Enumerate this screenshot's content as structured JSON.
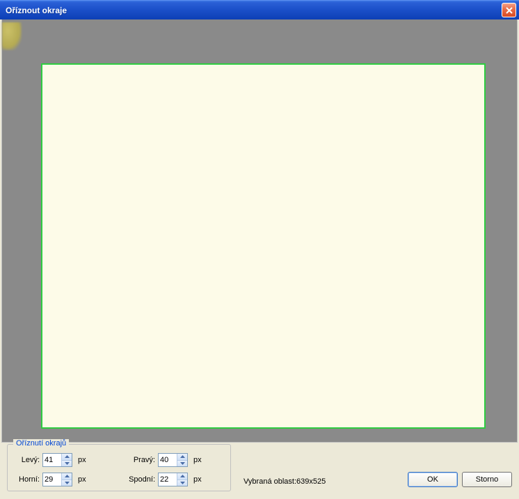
{
  "window": {
    "title": "Oříznout okraje"
  },
  "groupbox": {
    "title": "Oříznutí okrajů",
    "left": {
      "label": "Levý:",
      "value": "41",
      "unit": "px"
    },
    "right": {
      "label": "Pravý:",
      "value": "40",
      "unit": "px"
    },
    "top": {
      "label": "Horní:",
      "value": "29",
      "unit": "px"
    },
    "bottom": {
      "label": "Spodní:",
      "value": "22",
      "unit": "px"
    }
  },
  "status": {
    "label": "Vybraná oblast:639x525"
  },
  "buttons": {
    "ok": "OK",
    "cancel": "Storno"
  }
}
